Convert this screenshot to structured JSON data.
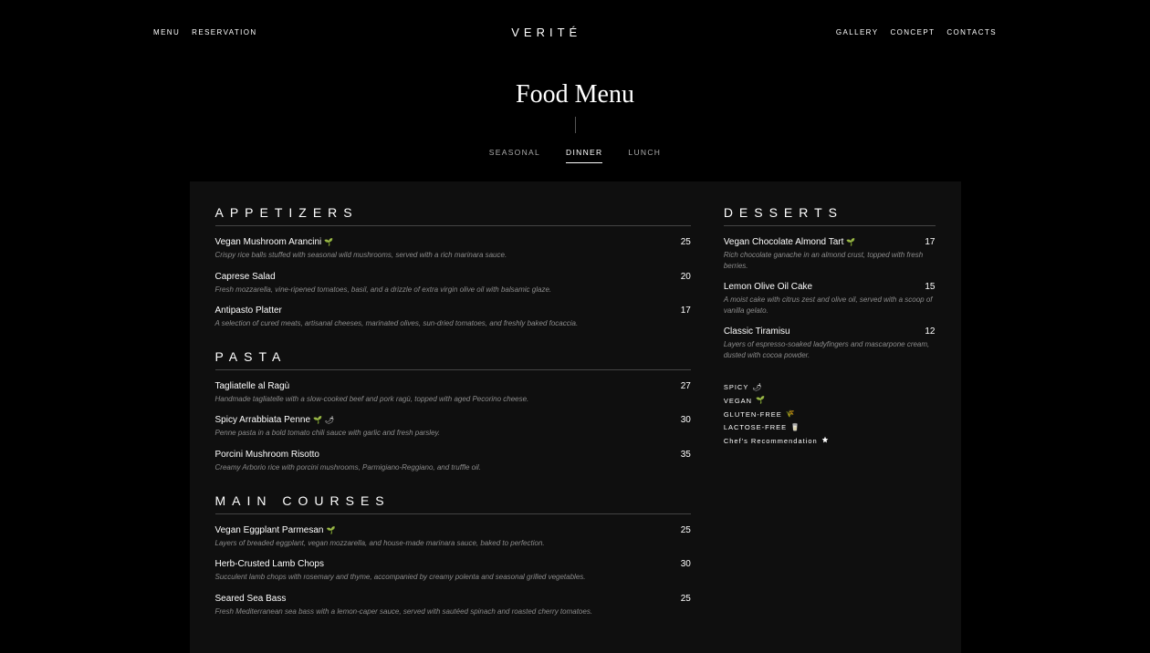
{
  "nav": {
    "left": [
      {
        "label": "MENU"
      },
      {
        "label": "RESERVATION"
      }
    ],
    "logo": "VERITÉ",
    "right": [
      {
        "label": "GALLERY"
      },
      {
        "label": "CONCEPT"
      },
      {
        "label": "CONTACTS"
      }
    ]
  },
  "page": {
    "title": "Food Menu"
  },
  "tabs": [
    {
      "label": "SEASONAL",
      "active": false
    },
    {
      "label": "DINNER",
      "active": true
    },
    {
      "label": "LUNCH",
      "active": false
    }
  ],
  "sections": {
    "appetizers": {
      "title": "APPETIZERS",
      "items": [
        {
          "name": "Vegan Mushroom Arancini",
          "icons": [
            "leaf"
          ],
          "price": "25",
          "desc": "Crispy rice balls stuffed with seasonal wild mushrooms, served with a rich marinara sauce."
        },
        {
          "name": "Caprese Salad",
          "icons": [],
          "price": "20",
          "desc": "Fresh mozzarella, vine-ripened tomatoes, basil, and a drizzle of extra virgin olive oil with balsamic glaze."
        },
        {
          "name": "Antipasto Platter",
          "icons": [],
          "price": "17",
          "desc": "A selection of cured meats, artisanal cheeses, marinated olives, sun-dried tomatoes, and freshly baked focaccia."
        }
      ]
    },
    "pasta": {
      "title": "PASTA",
      "items": [
        {
          "name": "Tagliatelle al Ragù",
          "icons": [],
          "price": "27",
          "desc": "Handmade tagliatelle with a slow-cooked beef and pork ragù, topped with aged Pecorino cheese."
        },
        {
          "name": "Spicy Arrabbiata Penne",
          "icons": [
            "leaf",
            "chili"
          ],
          "price": "30",
          "desc": "Penne pasta in a bold tomato chili sauce with garlic and fresh parsley."
        },
        {
          "name": "Porcini Mushroom Risotto",
          "icons": [],
          "price": "35",
          "desc": "Creamy Arborio rice with porcini mushrooms, Parmigiano-Reggiano, and truffle oil."
        }
      ]
    },
    "mains": {
      "title": "MAIN COURSES",
      "items": [
        {
          "name": "Vegan Eggplant Parmesan",
          "icons": [
            "leaf"
          ],
          "price": "25",
          "desc": "Layers of breaded eggplant, vegan mozzarella, and house-made marinara sauce, baked to perfection."
        },
        {
          "name": "Herb-Crusted Lamb Chops",
          "icons": [],
          "price": "30",
          "desc": "Succulent lamb chops with rosemary and thyme, accompanied by creamy polenta and seasonal grilled vegetables."
        },
        {
          "name": "Seared Sea Bass",
          "icons": [],
          "price": "25",
          "desc": "Fresh Mediterranean sea bass with a lemon-caper sauce, served with sautéed spinach and roasted cherry tomatoes."
        }
      ]
    },
    "desserts": {
      "title": "DESSERTS",
      "items": [
        {
          "name": "Vegan Chocolate Almond Tart",
          "icons": [
            "leaf"
          ],
          "price": "17",
          "desc": "Rich chocolate ganache in an almond crust, topped with fresh berries."
        },
        {
          "name": "Lemon Olive Oil Cake",
          "icons": [],
          "price": "15",
          "desc": "A moist cake with citrus zest and olive oil, served with a scoop of vanilla gelato."
        },
        {
          "name": "Classic Tiramisu",
          "icons": [],
          "price": "12",
          "desc": "Layers of espresso-soaked ladyfingers and mascarpone cream, dusted with cocoa powder."
        }
      ]
    }
  },
  "legend": {
    "spicy": "SPICY",
    "vegan": "VEGAN",
    "glutenfree": "GLUTEN-FREE",
    "lactosefree": "LACTOSE-FREE",
    "chef": "Chef's Recommendation"
  },
  "icons": {
    "leaf": "🌱",
    "chili": "🌶",
    "wheat": "🌾",
    "milk": "🥛"
  }
}
